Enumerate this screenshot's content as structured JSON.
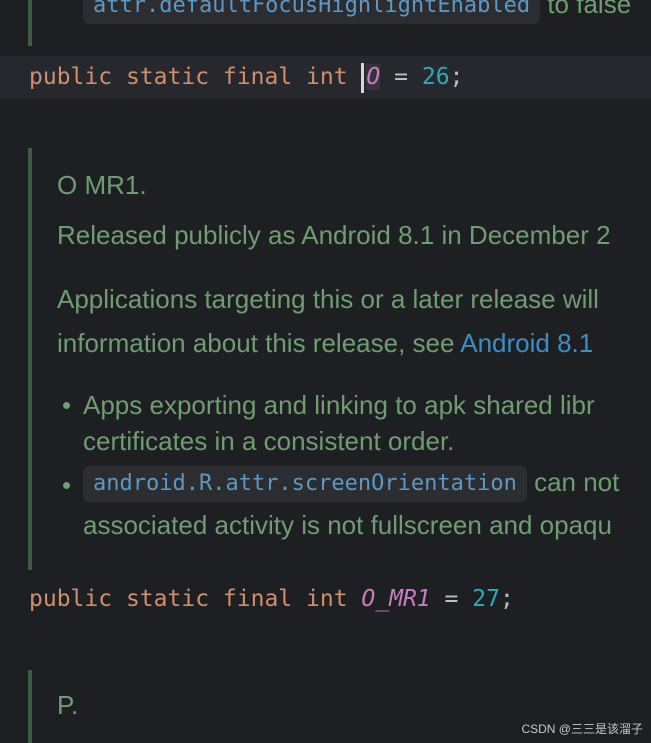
{
  "top_fragment": {
    "chip": "attr.defaultFocusHighlightEnabled",
    "text": "to false"
  },
  "line_o": {
    "kw1": "public",
    "kw2": "static",
    "kw3": "final",
    "kw4": "int",
    "name": "O",
    "eq": "=",
    "value": "26",
    "semi": ";"
  },
  "doc_omr1": {
    "title": "O MR1.",
    "released": "Released publicly as Android 8.1 in December 2",
    "apps_line1": "Applications targeting this or a later release will",
    "apps_line2_prefix": "information about this release, see",
    "apps_line2_link": "Android 8.1",
    "bullet1_line1": "Apps exporting and linking to apk shared libr",
    "bullet1_line2": "certificates in a consistent order.",
    "bullet2_chip": "android.R.attr.screenOrientation",
    "bullet2_tail": "can not",
    "bullet2_line2": "associated activity is not fullscreen and opaqu"
  },
  "line_omr1": {
    "kw1": "public",
    "kw2": "static",
    "kw3": "final",
    "kw4": "int",
    "name": "O_MR1",
    "eq": "=",
    "value": "27",
    "semi": ";"
  },
  "doc_p": {
    "title": "P."
  },
  "watermark": "CSDN @三三是该溜子"
}
